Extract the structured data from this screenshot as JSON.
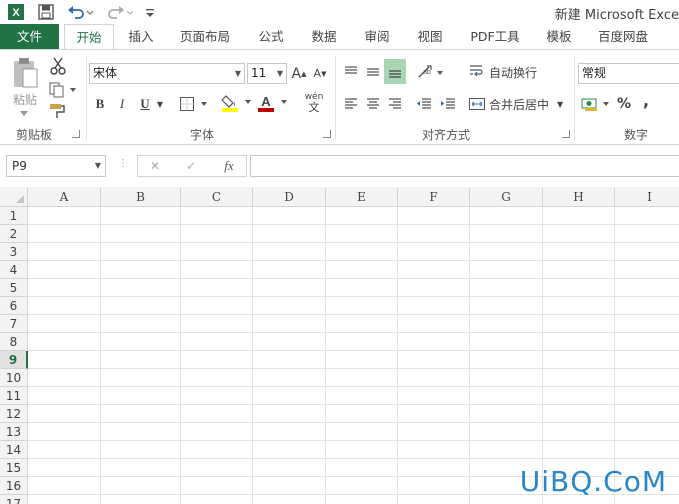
{
  "titlebar": {
    "title": "新建 Microsoft Exce",
    "quick_access": [
      "excel-logo-icon",
      "save-icon",
      "undo-icon",
      "redo-icon",
      "customize-icon"
    ]
  },
  "tabs": {
    "file": "文件",
    "items": [
      "开始",
      "插入",
      "页面布局",
      "公式",
      "数据",
      "审阅",
      "视图",
      "PDF工具",
      "模板",
      "百度网盘"
    ],
    "active": "开始"
  },
  "ribbon": {
    "clipboard": {
      "label": "剪贴板",
      "paste_label": "粘贴"
    },
    "font": {
      "label": "字体",
      "font_name": "宋体",
      "font_size": "11",
      "bold": "B",
      "italic": "I",
      "underline": "U",
      "grow": "A",
      "shrink": "A",
      "phonetic": "wén",
      "phonetic_char": "文",
      "fill_color": "#ffff00",
      "font_color": "#c00000"
    },
    "alignment": {
      "label": "对齐方式",
      "wrap_text": "自动换行",
      "merge_center": "合并后居中"
    },
    "number": {
      "label": "数字",
      "format": "常规",
      "percent": "%",
      "comma": ","
    }
  },
  "formula_bar": {
    "name_box": "P9",
    "cancel": "✕",
    "enter": "✓",
    "fx": "fx",
    "value": ""
  },
  "grid": {
    "columns": [
      "A",
      "B",
      "C",
      "D",
      "E",
      "F",
      "G",
      "H",
      "I"
    ],
    "rows": [
      "1",
      "2",
      "3",
      "4",
      "5",
      "6",
      "7",
      "8",
      "9",
      "10",
      "11",
      "12",
      "13",
      "14",
      "15",
      "16",
      "17"
    ],
    "selected_row": "9"
  },
  "watermark": "UiBQ.CoM",
  "colors": {
    "accent": "#217346",
    "watermark": "#2a86c8"
  }
}
